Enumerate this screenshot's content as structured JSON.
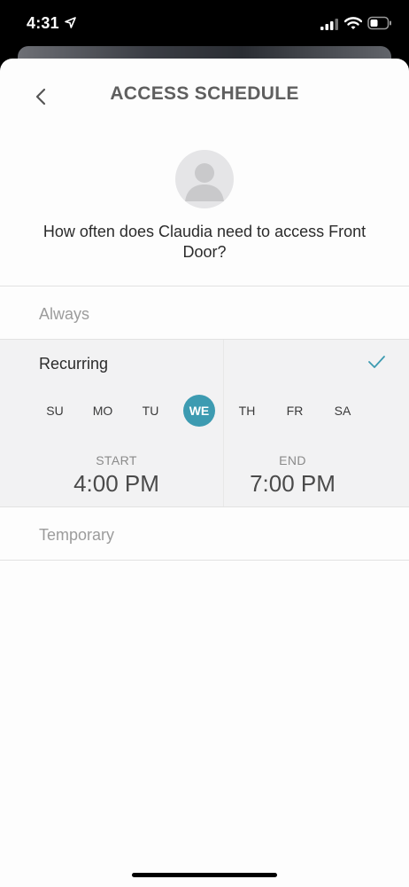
{
  "status_bar": {
    "time": "4:31",
    "icons": [
      "location-arrow-icon",
      "signal-icon",
      "wifi-icon",
      "battery-icon"
    ]
  },
  "header": {
    "back_icon": "chevron-left-icon",
    "title": "ACCESS SCHEDULE"
  },
  "prompt": {
    "avatar_icon": "user-placeholder-icon",
    "question": "How often does Claudia need to access Front Door?"
  },
  "options": {
    "always": "Always",
    "recurring": "Recurring",
    "temporary": "Temporary"
  },
  "recurring": {
    "selected": true,
    "check_icon": "checkmark-icon",
    "days": [
      "SU",
      "MO",
      "TU",
      "WE",
      "TH",
      "FR",
      "SA"
    ],
    "selected_day": "WE",
    "start_label": "START",
    "start_time": "4:00 PM",
    "end_label": "END",
    "end_time": "7:00 PM"
  },
  "colors": {
    "accent": "#3d9bb1",
    "panel_bg": "#f2f2f3",
    "muted_text": "#9c9c9c"
  }
}
